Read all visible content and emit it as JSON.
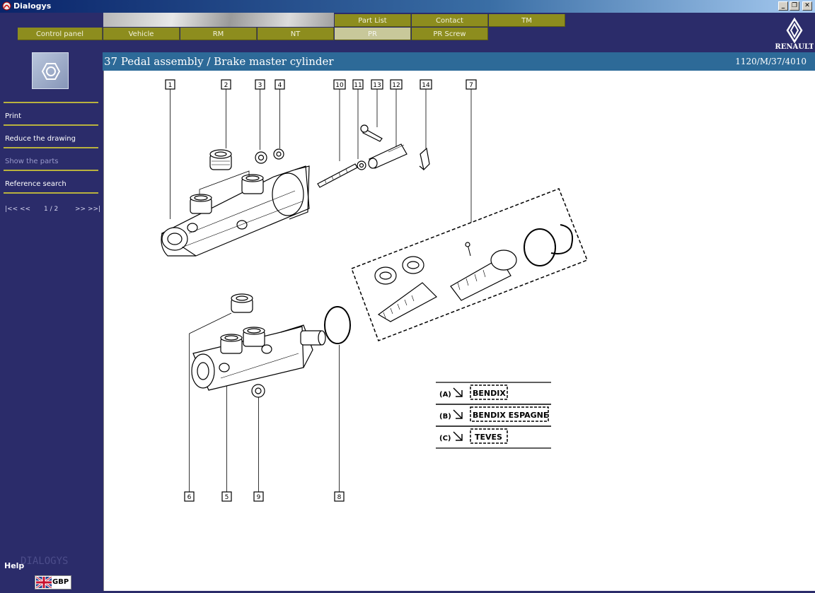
{
  "window": {
    "title": "Dialogys"
  },
  "top_tabs": [
    {
      "label": "Part List"
    },
    {
      "label": "Contact"
    },
    {
      "label": "TM"
    }
  ],
  "main_tabs": [
    {
      "label": "Control panel"
    },
    {
      "label": "Vehicle"
    },
    {
      "label": "RM"
    },
    {
      "label": "NT"
    },
    {
      "label": "PR",
      "active": true
    },
    {
      "label": "PR Screw"
    }
  ],
  "brand": {
    "logo_text": "RENAULT"
  },
  "page": {
    "title": "37 Pedal assembly / Brake master cylinder",
    "reference": "1120/M/37/4010"
  },
  "sidebar": {
    "items": [
      {
        "label": "Print",
        "enabled": true
      },
      {
        "label": "Reduce the drawing",
        "enabled": true
      },
      {
        "label": "Show the parts",
        "enabled": false
      },
      {
        "label": "Reference search",
        "enabled": true
      }
    ],
    "pager": {
      "first": "|<< <<",
      "page": "1 / 2",
      "next": ">> >>|"
    },
    "help": "Help",
    "product_logo": "DIALOGYS",
    "language": "GBP"
  },
  "drawing": {
    "callouts": [
      "1",
      "2",
      "3",
      "4",
      "10",
      "11",
      "13",
      "12",
      "14",
      "7",
      "6",
      "5",
      "9",
      "8"
    ],
    "legend": [
      {
        "code": "(A)",
        "name": "BENDIX"
      },
      {
        "code": "(B)",
        "name": "BENDIX ESPAGNE"
      },
      {
        "code": "(C)",
        "name": "TEVES"
      }
    ]
  },
  "colors": {
    "sidebar_bg": "#2b2c6a",
    "tab_bg": "#8d8d1e",
    "title_band": "#2d6a98",
    "accent_line": "#b9b23e"
  }
}
